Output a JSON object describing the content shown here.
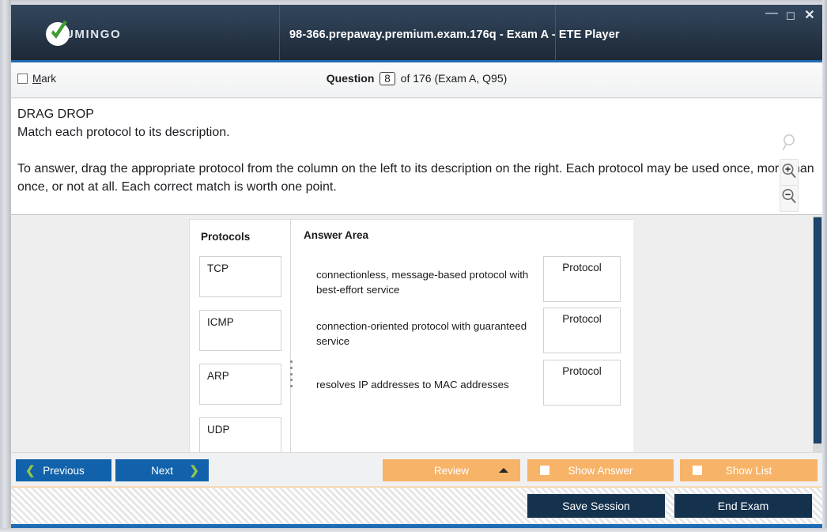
{
  "window": {
    "title": "98-366.prepaway.premium.exam.176q - Exam A - ETE Player",
    "logo_text": "UMINGO",
    "controls": {
      "minimize": "—",
      "maximize": "☐",
      "close": "✕"
    }
  },
  "question_header": {
    "mark_label_accelerator": "M",
    "mark_label_rest": "ark",
    "question_word": "Question",
    "question_number": "8",
    "of_text": "of 176 (Exam A, Q95)"
  },
  "question": {
    "type_label": "DRAG DROP",
    "prompt": "Match each protocol to its description.",
    "instructions": "To answer, drag the appropriate protocol from the column on the left to its description on the right. Each protocol may be used once, more than once, or not at all. Each correct match is worth one point."
  },
  "zoom_tools": {
    "search": "search-icon",
    "zoom_in": "zoom-in-icon",
    "zoom_out": "zoom-out-icon"
  },
  "exhibit": {
    "protocols_title": "Protocols",
    "protocols": [
      "TCP",
      "ICMP",
      "ARP",
      "UDP"
    ],
    "answer_title": "Answer Area",
    "answer_rows": [
      {
        "description": "connectionless, message-based protocol with best-effort service",
        "target": "Protocol"
      },
      {
        "description": "connection-oriented protocol with guaranteed service",
        "target": "Protocol"
      },
      {
        "description": "resolves IP addresses to MAC addresses",
        "target": "Protocol"
      }
    ]
  },
  "actions": {
    "previous": "Previous",
    "next": "Next",
    "review": "Review",
    "show_answer": "Show Answer",
    "show_list": "Show List",
    "save_session": "Save Session",
    "end_exam": "End Exam"
  },
  "colors": {
    "titlebar_dark": "#2b3c50",
    "accent_blue": "#1f6cb5",
    "button_blue": "#1162ab",
    "button_orange": "#f7b367",
    "button_dark": "#14314d",
    "chevron_green": "#8fc64e",
    "scrollbar_thumb": "#1f466f"
  }
}
